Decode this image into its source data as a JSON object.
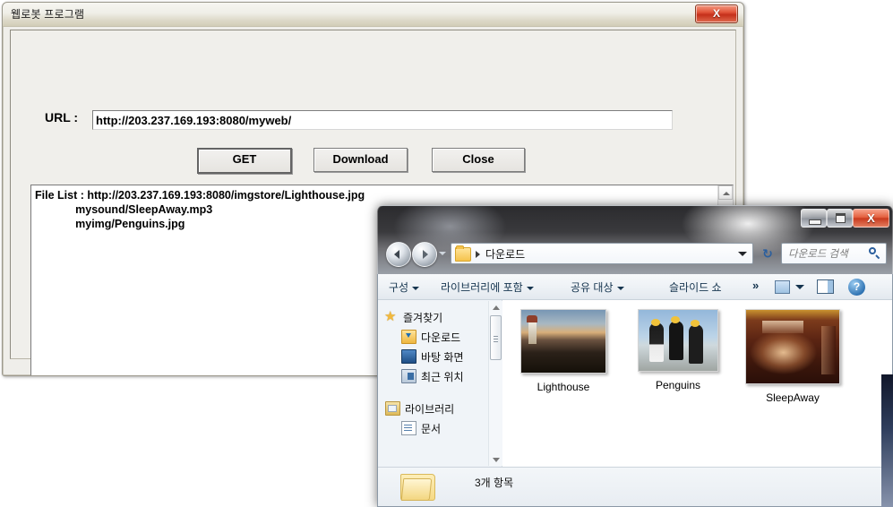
{
  "mfc": {
    "title": "웹로봇 프로그램",
    "close_label": "X",
    "url_label": "URL :",
    "url_value": "http://203.237.169.193:8080/myweb/",
    "buttons": {
      "get": "GET",
      "download": "Download",
      "close": "Close"
    },
    "file_list_text": "File List : http://203.237.169.193:8080/imgstore/Lighthouse.jpg\n             mysound/SleepAway.mp3\n             myimg/Penguins.jpg"
  },
  "explorer": {
    "window_controls": {
      "minimize": "",
      "maximize": "",
      "close": "X"
    },
    "address": {
      "crumb": "다운로드",
      "dropdown": "",
      "refresh": "↻"
    },
    "search": {
      "placeholder": "다운로드 검색"
    },
    "toolbar": [
      {
        "label": "구성",
        "has_caret": true
      },
      {
        "label": "라이브러리에 포함",
        "has_caret": true
      },
      {
        "label": "공유 대상",
        "has_caret": true
      },
      {
        "label": "슬라이드 쇼",
        "has_caret": false
      }
    ],
    "toolbar_overflow": "»",
    "toolbar_help": "?",
    "nav": {
      "favorites": {
        "label": "즐겨찾기",
        "icon": "star-icon"
      },
      "favorite_items": [
        {
          "label": "다운로드",
          "icon": "downloads-icon"
        },
        {
          "label": "바탕 화면",
          "icon": "desktop-icon"
        },
        {
          "label": "최근 위치",
          "icon": "recent-places-icon"
        }
      ],
      "libraries": {
        "label": "라이브러리",
        "icon": "library-icon"
      },
      "library_items": [
        {
          "label": "문서",
          "icon": "documents-icon"
        }
      ]
    },
    "files": [
      {
        "name": "Lighthouse",
        "thumb": "thumb-lighthouse"
      },
      {
        "name": "Penguins",
        "thumb": "thumb-penguins"
      },
      {
        "name": "SleepAway",
        "thumb": "thumb-sleepaway"
      }
    ],
    "status": {
      "item_count_text": "3개 항목"
    }
  },
  "colors": {
    "close_red": "#c5301a",
    "explorer_glass": "#3a3a3d",
    "accent_blue": "#2b5f9e",
    "folder_yellow": "#f5c34c"
  }
}
